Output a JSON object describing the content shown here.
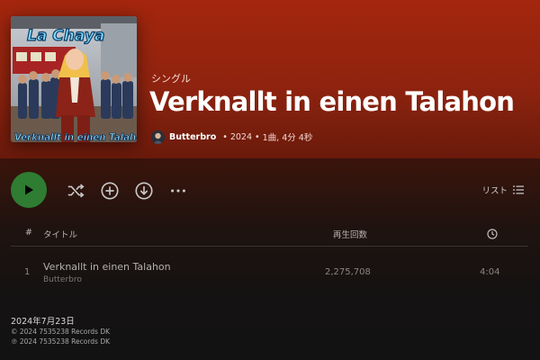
{
  "header": {
    "type_label": "シングル",
    "title": "Verknallt in einen Talahon",
    "artist": "Butterbro",
    "year": "2024",
    "summary": "1曲, 4分 4秒"
  },
  "cover": {
    "top_text": "La Chaya",
    "bottom_text": "Verknallt in einen Talahon"
  },
  "actions": {
    "play_icon": "play-icon",
    "shuffle_icon": "shuffle-icon",
    "add_icon": "add-circle-icon",
    "download_icon": "download-icon",
    "more_icon": "more-icon",
    "list_label": "リスト"
  },
  "table": {
    "headers": {
      "index": "#",
      "title": "タイトル",
      "plays": "再生回数"
    },
    "rows": [
      {
        "index": "1",
        "title": "Verknallt in einen Talahon",
        "artist": "Butterbro",
        "plays": "2,275,708",
        "duration": "4:04"
      }
    ]
  },
  "footer": {
    "release_date": "2024年7月23日",
    "copyright": "© 2024 7535238 Records DK",
    "phonographic": "℗ 2024 7535238 Records DK"
  },
  "colors": {
    "accent_green": "#2e7d32",
    "hero_red": "#a4260d"
  }
}
